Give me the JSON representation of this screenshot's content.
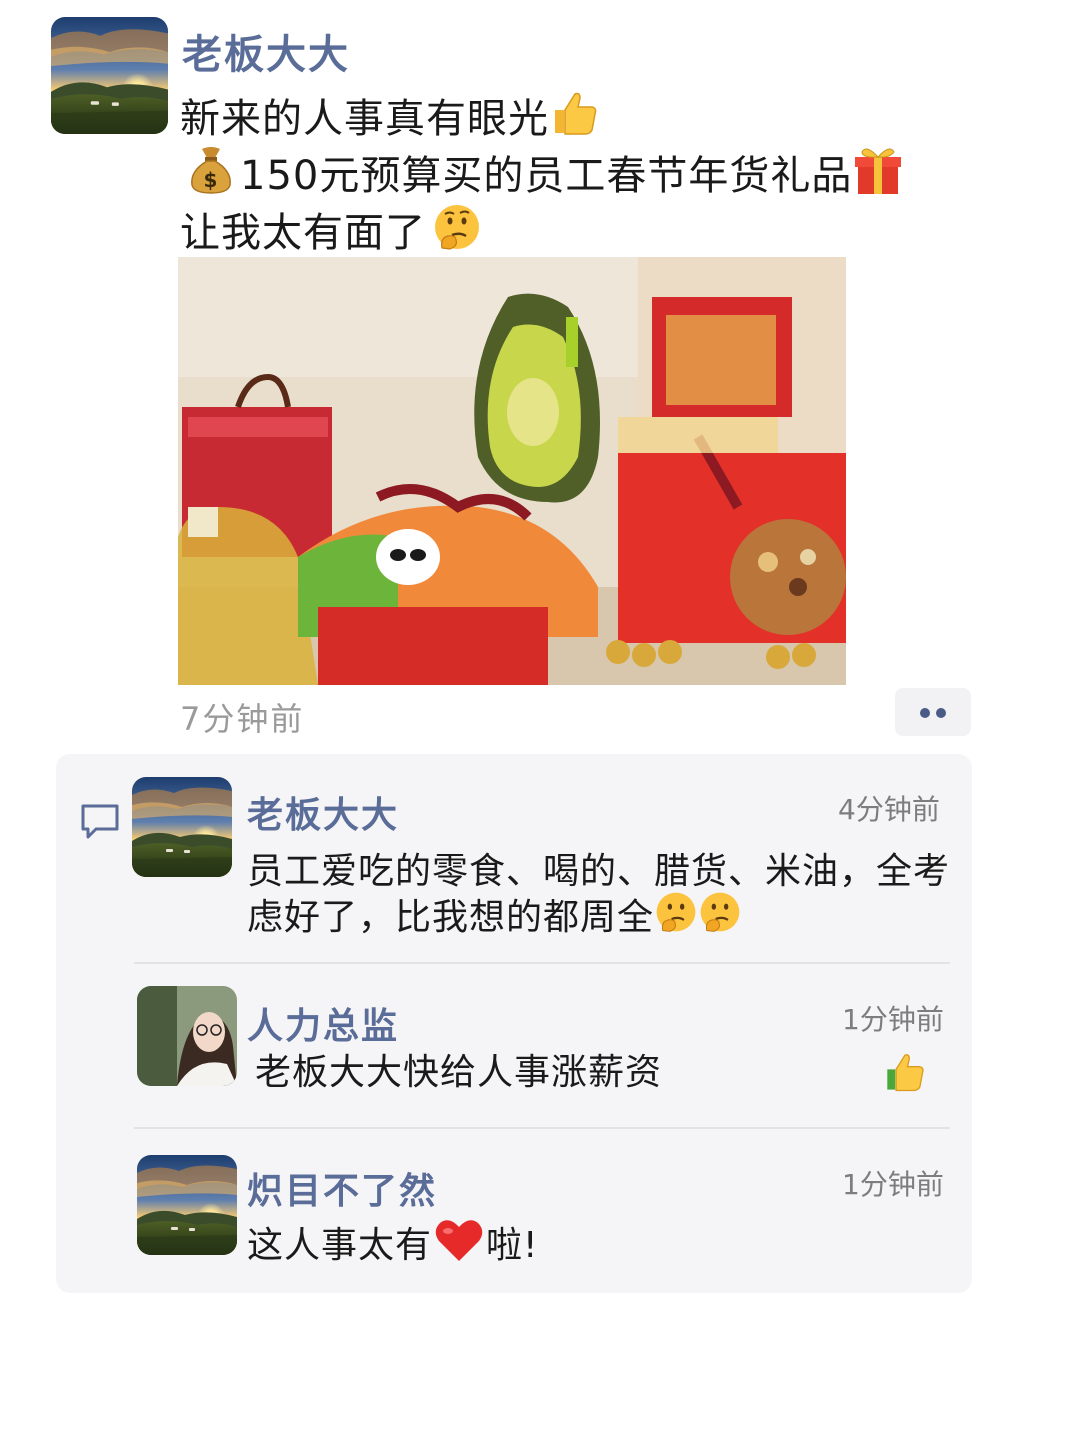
{
  "post": {
    "author": "老板大大",
    "line1": "新来的人事真有眼光",
    "line2": "150元预算买的员工春节年货礼品",
    "line3": "让我太有面了",
    "time": "7分钟前"
  },
  "comments": [
    {
      "author": "老板大大",
      "time": "4分钟前",
      "text_line1": "员工爱吃的零食、喝的、腊货、米油，全考",
      "text_line2": "虑好了，比我想的都周全"
    },
    {
      "author": "人力总监",
      "time": "1分钟前",
      "text": "老板大大快给人事涨薪资"
    },
    {
      "author": "炽目不了然",
      "time": "1分钟前",
      "text_before": "这人事太有",
      "text_after": "啦!"
    }
  ],
  "colors": {
    "name": "#5a6c98",
    "panel": "#f5f5f7",
    "time": "#7d7d7d"
  },
  "icons": [
    "thumbs-up-icon",
    "money-bag-icon",
    "gift-icon",
    "thinking-face-icon",
    "comment-icon",
    "heart-icon",
    "more-icon"
  ]
}
